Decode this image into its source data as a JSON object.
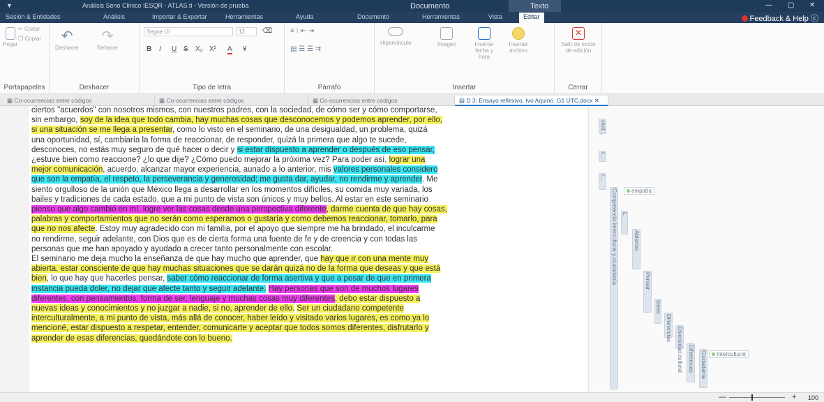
{
  "window": {
    "title": "Análisis Seno Clínico IESQR - ATLAS.ti - Versión de prueba",
    "context_doc": "Documento",
    "context_text": "Texto",
    "minimize": "—",
    "restore": "▢",
    "close": "✕"
  },
  "menu_tabs": [
    "Sesión & Entidades",
    "Análisis",
    "Importar & Exportar",
    "Herramientas",
    "Ayuda",
    "Documento",
    "Herramientas",
    "Vista",
    "Editar"
  ],
  "feedback": "Feedback & Help",
  "ribbon": {
    "portapapeles": {
      "label": "Portapapeles",
      "paste": "Pegar",
      "cut": "Cortar",
      "copy": "Copiar"
    },
    "deshacer": {
      "label": "Deshacer",
      "undo": "Deshacer",
      "redo": "Rehacer"
    },
    "tipo_letra": {
      "label": "Tipo de letra",
      "font": "Segoe UI",
      "size": "12",
      "bold": "B",
      "italic": "I",
      "underline": "U",
      "strike": "S",
      "sub": "X₂",
      "sup": "X²",
      "color": "A",
      "highlight": "¥"
    },
    "parrafo": {
      "label": "Párrafo"
    },
    "insertar": {
      "label": "Insertar",
      "hyperlink": "Hipervínculo",
      "image": "Imagen",
      "datetime": "Insertar fecha y hora",
      "insert_file": "Insertar\narchivo"
    },
    "cerrar": {
      "label": "Cerrar",
      "exit_edit": "Salir de modo de edición"
    }
  },
  "doc_tabs": [
    "Co-ocurrencias entre códigos",
    "Co-ocurrencias entre códigos",
    "Co-ocurrencias entre códigos",
    "D 3: Ensayo reflexivo. Ivo Aquino. G1 UTC.docx"
  ],
  "doc_tab_close": "✕",
  "document_lines": [
    [
      {
        "t": "ciertos \"acuerdos\" con nosotros mismos, con nuestros padres, con la sociedad, de cómo ser y cómo comportarse,",
        "h": ""
      }
    ],
    [
      {
        "t": "sin embargo, ",
        "h": ""
      },
      {
        "t": "soy de la idea que todo cambia, hay muchas cosas que desconocemos y podemos aprender, por ello,",
        "h": "y"
      }
    ],
    [
      {
        "t": "si una situación se me llega a presentar",
        "h": "y"
      },
      {
        "t": ", como lo visto en el seminario, de una desigualdad, un problema, quizá",
        "h": ""
      }
    ],
    [
      {
        "t": "una oportunidad, sí, cambiaría la forma de reaccionar, de responder, quizá la primera que algo te sucede,",
        "h": ""
      }
    ],
    [
      {
        "t": "desconoces, no estás muy seguro de qué hacer o decir y ",
        "h": ""
      },
      {
        "t": "si estar dispuesto a aprender o después de eso pensar,",
        "h": "c"
      }
    ],
    [
      {
        "t": "¿estuve bien como reaccione? ¿lo que dije? ¿Cómo puedo mejorar la próxima vez? Para poder así, ",
        "h": ""
      },
      {
        "t": "lograr una",
        "h": "y"
      }
    ],
    [
      {
        "t": "mejor comunicación",
        "h": "y"
      },
      {
        "t": ", acuerdo, alcanzar mayor experiencia, aunado a lo anterior, mis ",
        "h": ""
      },
      {
        "t": "valores personales considero",
        "h": "c"
      }
    ],
    [
      {
        "t": "que son la empatía, el respeto, la perseverancia y generosidad; me gusta dar, ayudar, no rendirme y aprender",
        "h": "c"
      },
      {
        "t": ". Me",
        "h": ""
      }
    ],
    [
      {
        "t": "siento orgulloso de la unión que México llega a desarrollar en los momentos difíciles, su comida muy variada, los",
        "h": ""
      }
    ],
    [
      {
        "t": "bailes y tradiciones de cada estado, que a mi punto de vista son únicos y muy bellos. Al estar en este seminario",
        "h": ""
      }
    ],
    [
      {
        "t": "pienso que algo cambió en mí, logre ver las cosas desde una perspectiva diferente",
        "h": "m"
      },
      {
        "t": ", darme cuenta de que hay cosas,",
        "h": "y"
      }
    ],
    [
      {
        "t": "palabras y comportamientos que no serán como esperamos o gustaría y como debemos reaccionar, tomarlo, para",
        "h": "y"
      }
    ],
    [
      {
        "t": "que no nos afecte",
        "h": "y"
      },
      {
        "t": ". Estoy muy agradecido con mi familia, por el apoyo que siempre me ha brindado, el inculcarme",
        "h": ""
      }
    ],
    [
      {
        "t": "no rendirme, seguir adelante, con Dios que es de cierta forma una fuente de fe y de creencia y con todas las",
        "h": ""
      }
    ],
    [
      {
        "t": "personas que me han apoyado y ayudado a crecer tanto personalmente con escolar.",
        "h": ""
      }
    ],
    [
      {
        "t": "El seminario me deja mucho la enseñanza de que hay mucho que aprender, que ",
        "h": ""
      },
      {
        "t": "hay que ir con una mente muy",
        "h": "y"
      }
    ],
    [
      {
        "t": "abierta, estar consciente de que hay muchas situaciones que se darán quizá no de la forma que deseas y que está",
        "h": "y"
      }
    ],
    [
      {
        "t": "bien",
        "h": "y"
      },
      {
        "t": ", lo que hay que hacerles pensar, ",
        "h": ""
      },
      {
        "t": "saber cómo reaccionar de forma asertiva y que a pesar de que en primera",
        "h": "c"
      }
    ],
    [
      {
        "t": "instancia pueda doler, no dejar que afecte tanto y seguir adelante.",
        "h": "c"
      },
      {
        "t": " ",
        "h": ""
      },
      {
        "t": "Hay personas que son de muchos lugares",
        "h": "m"
      }
    ],
    [
      {
        "t": "diferentes, con pensamientos, forma de ser, lenguaje y muchas cosas muy diferentes",
        "h": "m"
      },
      {
        "t": ", debo estar dispuesto a",
        "h": "y"
      }
    ],
    [
      {
        "t": "nuevas ideas y conocimientos y no juzgar a nadie, si no, aprender de ello.",
        "h": "y"
      },
      {
        "t": " ",
        "h": ""
      },
      {
        "t": "Ser un ciudadano competente",
        "h": "y"
      }
    ],
    [
      {
        "t": "interculturalmente, a mi punto de vista, más allá de conocer, haber leído y visitado varios lugares, es como ya lo",
        "h": "y"
      }
    ],
    [
      {
        "t": "mencioné, estar dispuesto a respetar, entender, comunicarte y aceptar que todos somos diferentes, disfrutarlo y",
        "h": "y"
      }
    ],
    [
      {
        "t": "aprender de esas diferencias, quedándote con lo bueno.",
        "h": "y"
      }
    ]
  ],
  "margin": {
    "tag_empatia": "empatía",
    "tag_intercultural": "Intercultural",
    "labels": [
      "ciud...",
      "r...",
      "r...",
      "L",
      "Competencia intercultural y ciudadanía",
      "Diversidad cultural",
      "Abiertos",
      "Pensar",
      "Diferencias",
      "Ideas",
      "Ciudadanía"
    ]
  },
  "status": {
    "zoom_minus": "—",
    "zoom_plus": "+",
    "zoom_pct": "100"
  }
}
